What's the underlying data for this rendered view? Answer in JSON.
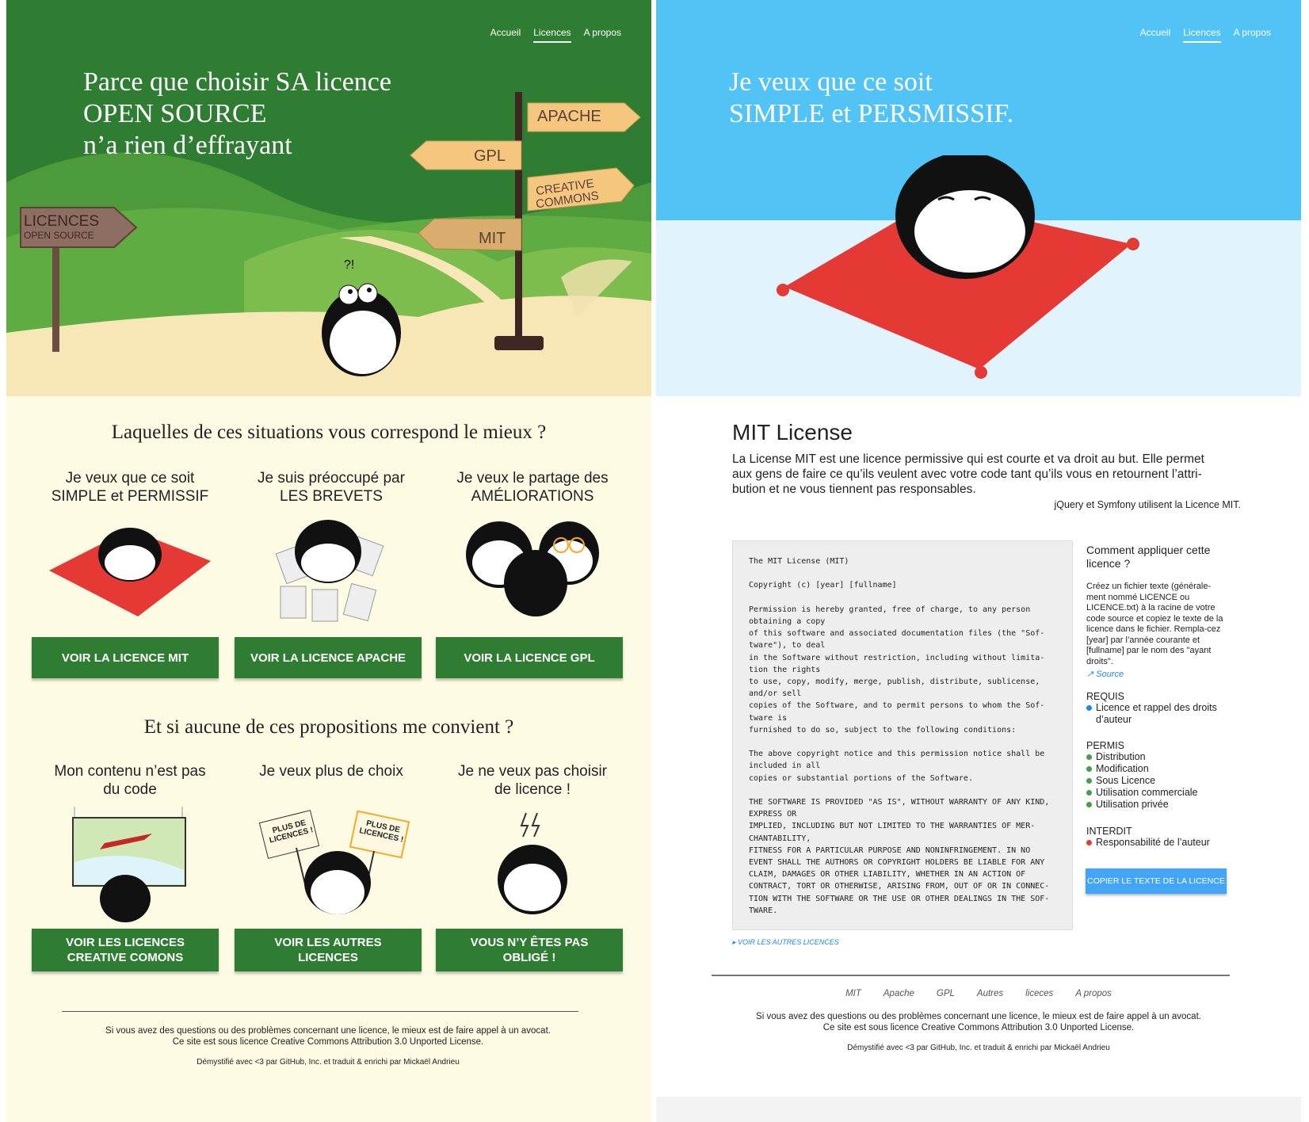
{
  "colors": {
    "green": "#2e7d32",
    "green_hero": "#2f7d32",
    "blue_hero": "#52c3f5",
    "cream": "#fefbe4",
    "blue_btn": "#42a5f5"
  },
  "left": {
    "nav": [
      "Accueil",
      "Licences",
      "A propos"
    ],
    "hero": {
      "title_lines": [
        "Parce que choisir SA licence",
        "OPEN SOURCE",
        "n’a rien d’effrayant"
      ],
      "sign_main": "LICENCES",
      "sign_sub": "OPEN SOURCE",
      "arrows": [
        "APACHE",
        "GPL",
        "CREATIVE",
        "COMMONS",
        "MIT"
      ],
      "penguin_text": "?!"
    },
    "section1": {
      "title": "Laquelles de ces situations vous correspond le mieux ?",
      "options": [
        {
          "q1": "Je veux que ce soit",
          "q2": "SIMPLE et PERMISSIF",
          "btn": "VOIR LA LICENCE MIT"
        },
        {
          "q1": "Je suis préoccupé par",
          "q2": "LES BREVETS",
          "btn": "VOIR LA LICENCE APACHE"
        },
        {
          "q1": "Je veux le partage des",
          "q2": "AMÉLIORATIONS",
          "btn": "VOIR LA LICENCE GPL"
        }
      ]
    },
    "section2": {
      "title": "Et si aucune de ces propositions me convient ?",
      "options": [
        {
          "q1": "Mon contenu n’est pas",
          "q2": "du code",
          "btn1": "VOIR LES LICENCES",
          "btn2": "CREATIVE COMONS"
        },
        {
          "q1": "Je veux plus de choix",
          "q2": "",
          "btn1": "VOIR LES AUTRES",
          "btn2": "LICENCES"
        },
        {
          "q1": "Je ne veux pas choisir",
          "q2": "de licence !",
          "btn1": "VOUS N’Y ÊTES PAS",
          "btn2": "OBLIGÉ !"
        }
      ],
      "sign1": "PLUS DE",
      "sign2": "LICENCES !"
    },
    "footer": {
      "line1": "Si vous avez des questions ou des problèmes concernant une licence, le mieux est de faire appel à un avocat.",
      "line2": "Ce site est sous licence Creative Commons Attribution 3.0 Unported License.",
      "line3": "Démystifié avec <3 par GitHub, Inc. et traduit & enrichi par Mickaël Andrieu"
    }
  },
  "right": {
    "nav": [
      "Accueil",
      "Licences",
      "A propos"
    ],
    "hero_title_lines": [
      "Je veux que ce soit",
      "SIMPLE et PERSMISSIF."
    ],
    "license_title": "MIT License",
    "intro_lines": [
      "La License MIT est une licence permissive qui est courte et va droit au but. Elle permet",
      "aux gens de faire ce qu’ils veulent avec votre code tant qu’ils vous en retournent l’attri-",
      "bution et ne vous tiennent pas responsables."
    ],
    "users": "jQuery et Symfony utilisent la Licence MIT.",
    "license_text": "The MIT License (MIT)\n\nCopyright (c) [year] [fullname]\n\nPermission is hereby granted, free of charge, to any person\nobtaining a copy\nof this software and associated documentation files (the \"Sof-\ntware\"), to deal\nin the Software without restriction, including without limita-\ntion the rights\nto use, copy, modify, merge, publish, distribute, sublicense,\nand/or sell\ncopies of the Software, and to permit persons to whom the Sof-\ntware is\nfurnished to do so, subject to the following conditions:\n\nThe above copyright notice and this permission notice shall be\nincluded in all\ncopies or substantial portions of the Software.\n\nTHE SOFTWARE IS PROVIDED \"AS IS\", WITHOUT WARRANTY OF ANY KIND,\nEXPRESS OR\nIMPLIED, INCLUDING BUT NOT LIMITED TO THE WARRANTIES OF MER-\nCHANTABILITY,\nFITNESS FOR A PARTICULAR PURPOSE AND NONINFRINGEMENT. IN NO\nEVENT SHALL THE AUTHORS OR COPYRIGHT HOLDERS BE LIABLE FOR ANY\nCLAIM, DAMAGES OR OTHER LIABILITY, WHETHER IN AN ACTION OF\nCONTRACT, TORT OR OTHERWISE, ARISING FROM, OUT OF OR IN CONNEC-\nTION WITH THE SOFTWARE OR THE USE OR OTHER DEALINGS IN THE SOF-\nTWARE.",
    "how_title": "Comment appliquer cette licence ?",
    "how_text": "Créez un fichier texte (générale-ment nommé LICENCE ou LICENCE.txt) à la racine de votre code source et copiez le texte de la licence dans le fichier. Rempla-cez [year] par l’année courante et [fullname] par le nom des \"ayant droits\".",
    "source_link": "Source",
    "requis_title": "REQUIS",
    "requis": [
      "Licence et rappel des droits d’auteur"
    ],
    "permis_title": "PERMIS",
    "permis": [
      "Distribution",
      "Modification",
      "Sous Licence",
      "Utilisation commerciale",
      "Utilisation privée"
    ],
    "interdit_title": "INTERDIT",
    "interdit": [
      "Responsabilité de l’auteur"
    ],
    "copy_btn": "COPIER LE TEXTE DE LA LICENCE",
    "other_link": "VOIR LES AUTRES LICENCES",
    "footer_nav": [
      "MIT",
      "Apache",
      "GPL",
      "Autres",
      "liceces",
      "A propos"
    ],
    "footer": {
      "line1": "Si vous avez des questions ou des problèmes concernant une licence, le mieux est de faire appel à un avocat.",
      "line2": "Ce site est sous licence Creative Commons Attribution 3.0 Unported License.",
      "line3": "Démystifié avec <3 par GitHub, Inc. et traduit & enrichi par Mickaël Andrieu"
    }
  }
}
